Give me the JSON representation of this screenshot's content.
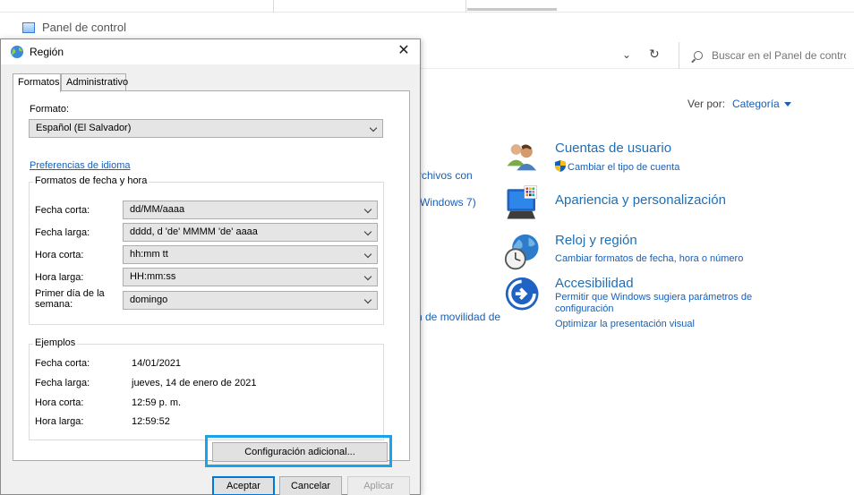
{
  "control_panel": {
    "title": "Panel de control",
    "search_placeholder": "Buscar en el Panel de control",
    "view_by_label": "Ver por:",
    "view_by_value": "Categoría",
    "partial_texts": [
      "rchivos con",
      "Windows 7)",
      "n de movilidad de"
    ],
    "categories": [
      {
        "title": "Cuentas de usuario",
        "icon": "users-icon",
        "links": [
          "Cambiar el tipo de cuenta"
        ]
      },
      {
        "title": "Apariencia y personalización",
        "icon": "monitor-palette-icon",
        "links": []
      },
      {
        "title": "Reloj y región",
        "icon": "globe-clock-icon",
        "links": [
          "Cambiar formatos de fecha, hora o número"
        ]
      },
      {
        "title": "Accesibilidad",
        "icon": "accessibility-icon",
        "links": [
          "Permitir que Windows sugiera parámetros de",
          "configuración",
          "Optimizar la presentación visual"
        ]
      }
    ]
  },
  "dialog": {
    "title": "Región",
    "tabs": [
      "Formatos",
      "Administrativo"
    ],
    "format_label": "Formato:",
    "format_value": "Español (El Salvador)",
    "language_prefs_link": "Preferencias de idioma",
    "datetime_group": {
      "legend": "Formatos de fecha y hora",
      "rows": [
        {
          "label": "Fecha corta:",
          "value": "dd/MM/aaaa"
        },
        {
          "label": "Fecha larga:",
          "value": "dddd, d 'de' MMMM 'de' aaaa"
        },
        {
          "label": "Hora corta:",
          "value": "hh:mm tt"
        },
        {
          "label": "Hora larga:",
          "value": "HH:mm:ss"
        },
        {
          "label": "Primer día de la semana:",
          "label_line1": "Primer día de la",
          "label_line2": "semana:",
          "value": "domingo"
        }
      ]
    },
    "examples_group": {
      "legend": "Ejemplos",
      "rows": [
        {
          "label": "Fecha corta:",
          "value": "14/01/2021"
        },
        {
          "label": "Fecha larga:",
          "value": "jueves, 14 de enero de 2021"
        },
        {
          "label": "Hora corta:",
          "value": "12:59 p. m."
        },
        {
          "label": "Hora larga:",
          "value": "12:59:52"
        }
      ]
    },
    "additional_settings_button": "Configuración adicional...",
    "ok_button": "Aceptar",
    "cancel_button": "Cancelar",
    "apply_button": "Aplicar"
  },
  "colors": {
    "link": "#1a5fb4",
    "highlight": "#1aa3e8",
    "accent": "#0078d7"
  }
}
